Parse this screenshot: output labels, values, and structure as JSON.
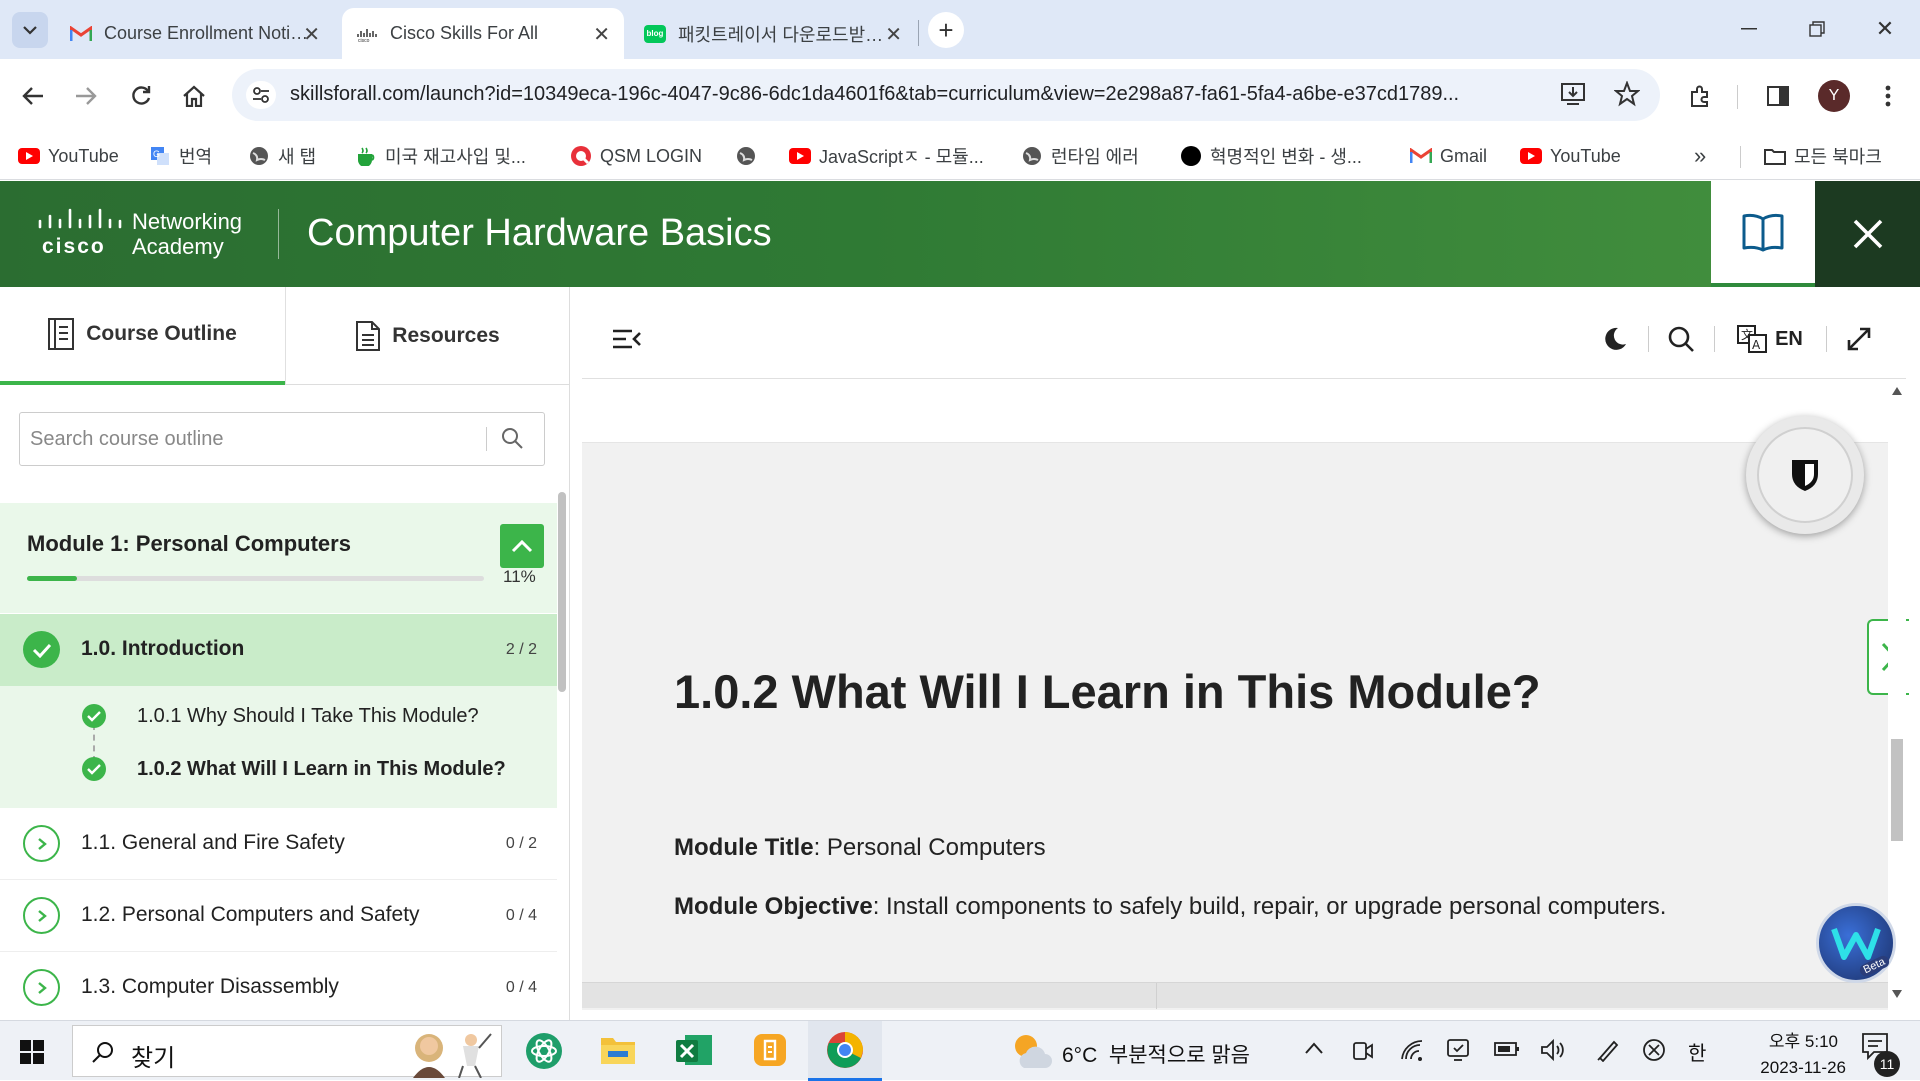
{
  "browser": {
    "tabs": [
      {
        "title": "Course Enrollment Notification",
        "icon": "gmail-icon",
        "active": false
      },
      {
        "title": "Cisco Skills For All",
        "icon": "cisco-icon",
        "active": true
      },
      {
        "title": "패킷트레이서 다운로드받기 : L",
        "icon": "blog-icon",
        "active": false
      }
    ],
    "url": "skillsforall.com/launch?id=10349eca-196c-4047-9c86-6dc1da4601f6&tab=curriculum&view=2e298a87-fa61-5fa4-a6be-e37cd1789...",
    "profile_initial": "Y",
    "bookmarks": [
      {
        "label": "YouTube",
        "icon": "youtube-icon"
      },
      {
        "label": "번역",
        "icon": "translate-icon"
      },
      {
        "label": "새 탭",
        "icon": "globe-icon"
      },
      {
        "label": "미국 재고사입 및...",
        "icon": "cup-icon"
      },
      {
        "label": "QSM LOGIN",
        "icon": "q-icon"
      },
      {
        "label": "",
        "icon": "globe-icon"
      },
      {
        "label": "JavaScriptㅈ - 모듈...",
        "icon": "youtube-icon"
      },
      {
        "label": "런타임 에러",
        "icon": "globe-icon"
      },
      {
        "label": "혁명적인 변화 - 생...",
        "icon": "dot-icon"
      },
      {
        "label": "Gmail",
        "icon": "gmail-icon"
      },
      {
        "label": "YouTube",
        "icon": "youtube-icon"
      }
    ],
    "bookmarks_overflow": "»",
    "all_bookmarks": "모든 북마크"
  },
  "app": {
    "logo_line1": "Networking",
    "logo_line2": "Academy",
    "logo_word": "cisco",
    "course_title": "Computer Hardware Basics"
  },
  "sidebar": {
    "tabs": [
      {
        "label": "Course Outline",
        "active": true
      },
      {
        "label": "Resources",
        "active": false
      }
    ],
    "search_placeholder": "Search course outline",
    "module": {
      "title": "Module 1: Personal Computers",
      "progress_text": "11%",
      "progress": 0.11
    },
    "sections": [
      {
        "label": "1.0. Introduction",
        "count": "2 / 2",
        "complete": true
      },
      {
        "label": "1.1. General and Fire Safety",
        "count": "0 / 2",
        "complete": false
      },
      {
        "label": "1.2. Personal Computers and Safety",
        "count": "0 / 4",
        "complete": false
      },
      {
        "label": "1.3. Computer Disassembly",
        "count": "0 / 4",
        "complete": false
      }
    ],
    "subsections": [
      {
        "label": "1.0.1 Why Should I Take This Module?",
        "current": false
      },
      {
        "label": "1.0.2 What Will I Learn in This Module?",
        "current": true
      }
    ]
  },
  "content": {
    "language": "EN",
    "lesson_title": "1.0.2 What Will I Learn in This Module?",
    "module_title_label": "Module Title",
    "module_title_value": ": Personal Computers",
    "module_objective_label": "Module Objective",
    "module_objective_value": ": Install components to safely build, repair, or upgrade personal computers.",
    "beta_label": "Beta"
  },
  "taskbar": {
    "search_label": "찾기",
    "weather": "6°C  부분적으로 맑음",
    "ime": "한",
    "time": "오후 5:10",
    "date": "2023-11-26",
    "notification_count": "11"
  },
  "colors": {
    "header_green": "#2f7a34",
    "accent_green": "#3cb54a",
    "active_row": "#c9ecc9",
    "subsection_bg": "#eaf7ea"
  }
}
